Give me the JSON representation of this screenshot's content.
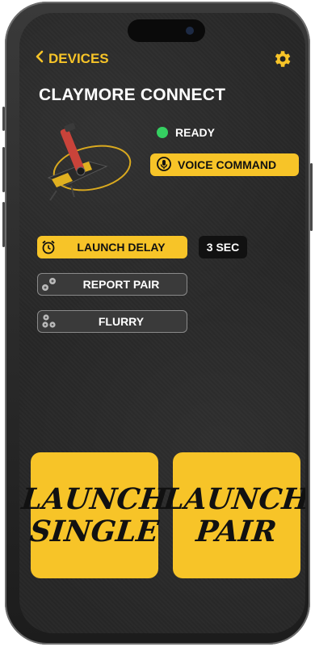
{
  "nav": {
    "back_label": "DEVICES"
  },
  "header": {
    "title": "CLAYMORE CONNECT"
  },
  "status": {
    "label": "READY",
    "color": "#35d061"
  },
  "voice": {
    "label": "VOICE COMMAND"
  },
  "modes": [
    {
      "label": "LAUNCH DELAY",
      "active": true,
      "icon": "alarm-clock-icon"
    },
    {
      "label": "REPORT PAIR",
      "active": false,
      "icon": "report-pair-icon"
    },
    {
      "label": "FLURRY",
      "active": false,
      "icon": "flurry-icon"
    }
  ],
  "delay": {
    "value": "3 SEC"
  },
  "launch_single": {
    "line1": "LAUNCH",
    "line2": "SINGLE"
  },
  "launch_pair": {
    "line1": "LAUNCH",
    "line2": "PAIR"
  },
  "colors": {
    "accent": "#f7c428",
    "background": "#232323"
  }
}
